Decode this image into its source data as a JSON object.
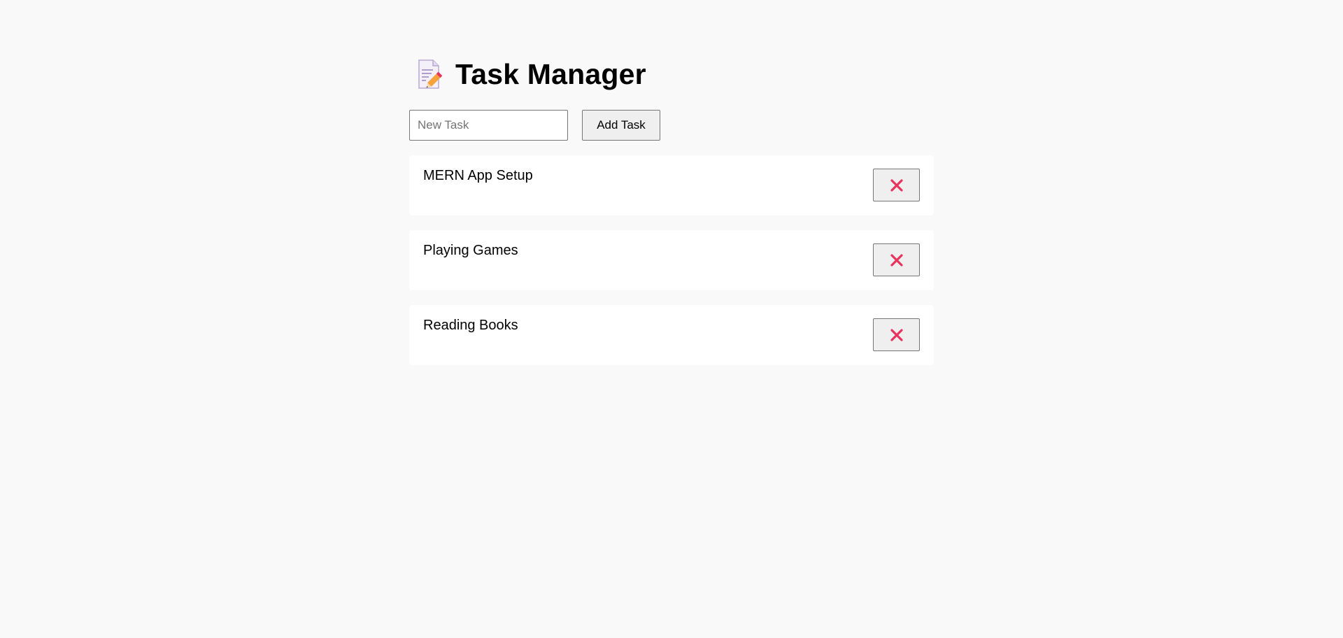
{
  "header": {
    "title": "Task Manager",
    "icon": "memo-pencil-icon"
  },
  "add_form": {
    "placeholder": "New Task",
    "value": "",
    "button_label": "Add Task"
  },
  "tasks": [
    {
      "text": "MERN App Setup"
    },
    {
      "text": "Playing Games"
    },
    {
      "text": "Reading Books"
    }
  ],
  "colors": {
    "background": "#f9f9f9",
    "card": "#ffffff",
    "delete_icon": "#e8335c"
  }
}
